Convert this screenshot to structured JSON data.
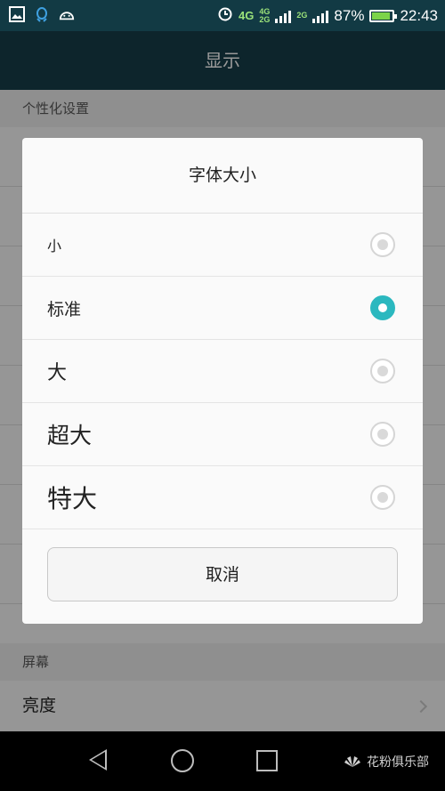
{
  "status_bar": {
    "network_primary": "4G",
    "network_secondary_top": "4G",
    "network_secondary_bottom": "2G",
    "network_tertiary": "2G",
    "battery": "87%",
    "battery_level": 0.87,
    "time": "22:43"
  },
  "title_bar": {
    "title": "显示"
  },
  "background": {
    "section_personalization": "个性化设置",
    "section_screen": "屏幕",
    "brightness": "亮度"
  },
  "dialog": {
    "title": "字体大小",
    "options": [
      {
        "label": "小",
        "selected": false
      },
      {
        "label": "标准",
        "selected": true
      },
      {
        "label": "大",
        "selected": false
      },
      {
        "label": "超大",
        "selected": false
      },
      {
        "label": "特大",
        "selected": false
      }
    ],
    "cancel_label": "取消"
  },
  "nav_bar": {
    "watermark_brand": "HUAWEI",
    "watermark_text": "花粉俱乐部"
  },
  "colors": {
    "accent": "#2bb8bf",
    "title_bar": "#163f4a",
    "status_bar": "#123a44"
  }
}
